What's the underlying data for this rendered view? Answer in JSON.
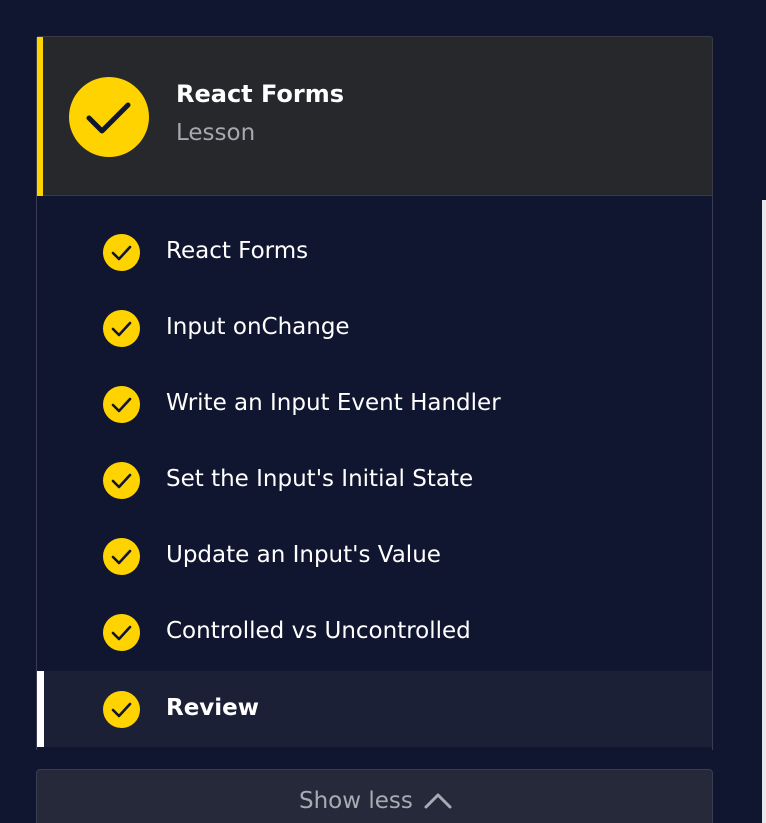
{
  "lesson": {
    "title": "React Forms",
    "subtitle": "Lesson"
  },
  "steps": [
    {
      "label": "React Forms",
      "completed": true
    },
    {
      "label": "Input onChange",
      "completed": true
    },
    {
      "label": "Write an Input Event Handler",
      "completed": true
    },
    {
      "label": "Set the Input's Initial State",
      "completed": true
    },
    {
      "label": "Update an Input's Value",
      "completed": true
    },
    {
      "label": "Controlled vs Uncontrolled",
      "completed": true
    },
    {
      "label": "Review",
      "completed": true,
      "active": true
    }
  ],
  "toggle": {
    "label": "Show less",
    "icon": "chevron-up-icon"
  },
  "colors": {
    "background": "#10162f",
    "accent": "#ffd300",
    "header_bg": "#27282c",
    "active_row": "#1b2037",
    "text": "#ffffff",
    "muted_text": "#a7a8ad"
  }
}
